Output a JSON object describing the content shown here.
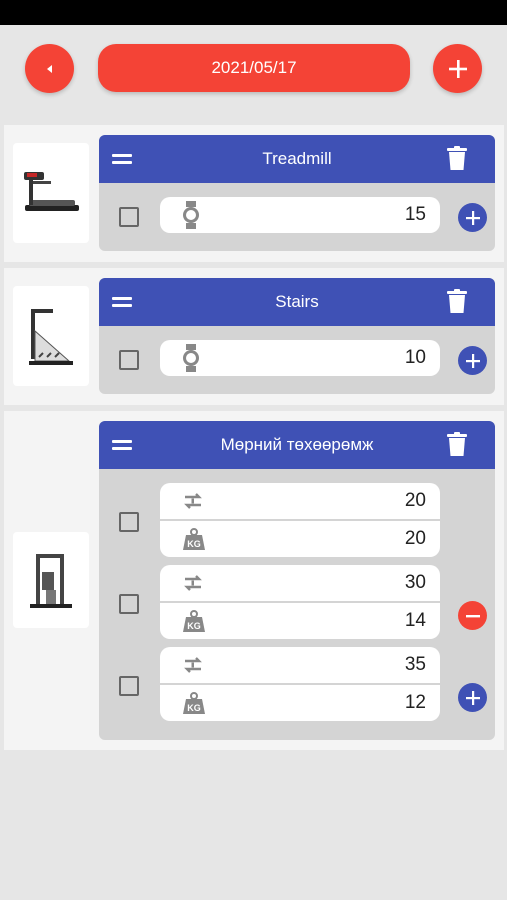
{
  "header": {
    "date": "2021/05/17",
    "back_icon": "back-arrow-icon",
    "add_icon": "plus-icon"
  },
  "colors": {
    "accent_red": "#f44336",
    "accent_blue": "#3f51b5",
    "background": "#e6e6e6"
  },
  "exercises": [
    {
      "name": "Treadmill",
      "thumbnail": "treadmill-image",
      "sets": [
        {
          "icon": "watch-icon",
          "value": "15"
        }
      ]
    },
    {
      "name": "Stairs",
      "thumbnail": "stair-climber-image",
      "sets": [
        {
          "icon": "watch-icon",
          "value": "10"
        }
      ]
    },
    {
      "name": "Мөрний төхөөрөмж",
      "thumbnail": "shoulder-machine-image",
      "sets": [
        {
          "reps_icon": "repeat-icon",
          "reps": "20",
          "weight_icon": "kg-weight-icon",
          "weight": "20"
        },
        {
          "reps_icon": "repeat-icon",
          "reps": "30",
          "weight_icon": "kg-weight-icon",
          "weight": "14"
        },
        {
          "reps_icon": "repeat-icon",
          "reps": "35",
          "weight_icon": "kg-weight-icon",
          "weight": "12"
        }
      ]
    }
  ]
}
